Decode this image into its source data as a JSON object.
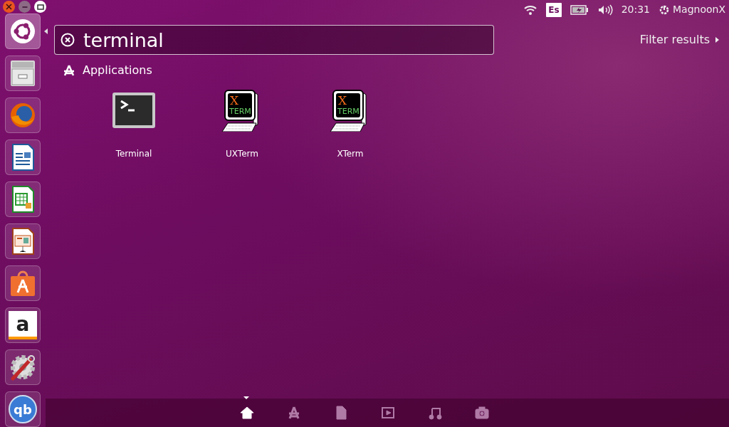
{
  "window_controls": [
    {
      "kind": "close"
    },
    {
      "kind": "minimize"
    },
    {
      "kind": "maximize"
    }
  ],
  "panel": {
    "keyboard_layout": "Es",
    "time": "20:31",
    "user": "MagnoonX"
  },
  "launcher": [
    {
      "kind": "ubuntu",
      "active": true
    },
    {
      "kind": "files",
      "active": false
    },
    {
      "kind": "firefox",
      "active": false
    },
    {
      "kind": "writer",
      "active": false
    },
    {
      "kind": "calc",
      "active": false
    },
    {
      "kind": "impress",
      "active": false
    },
    {
      "kind": "software",
      "active": false
    },
    {
      "kind": "amazon",
      "active": false,
      "glyph": "a"
    },
    {
      "kind": "settings",
      "active": false
    },
    {
      "kind": "qbittorrent",
      "active": false,
      "glyph": "qb"
    }
  ],
  "search": {
    "value": "terminal"
  },
  "filter": {
    "label": "Filter results"
  },
  "category": {
    "label": "Applications"
  },
  "results": [
    {
      "kind": "terminal",
      "name": "Terminal"
    },
    {
      "kind": "xterm",
      "name": "UXTerm",
      "logo": [
        "X",
        "TERM"
      ]
    },
    {
      "kind": "xterm",
      "name": "XTerm",
      "logo": [
        "X",
        "TERM"
      ]
    }
  ],
  "lenses": [
    {
      "kind": "home",
      "selected": true
    },
    {
      "kind": "applications",
      "selected": false
    },
    {
      "kind": "files",
      "selected": false
    },
    {
      "kind": "video",
      "selected": false
    },
    {
      "kind": "music",
      "selected": false
    },
    {
      "kind": "photos",
      "selected": false
    }
  ]
}
